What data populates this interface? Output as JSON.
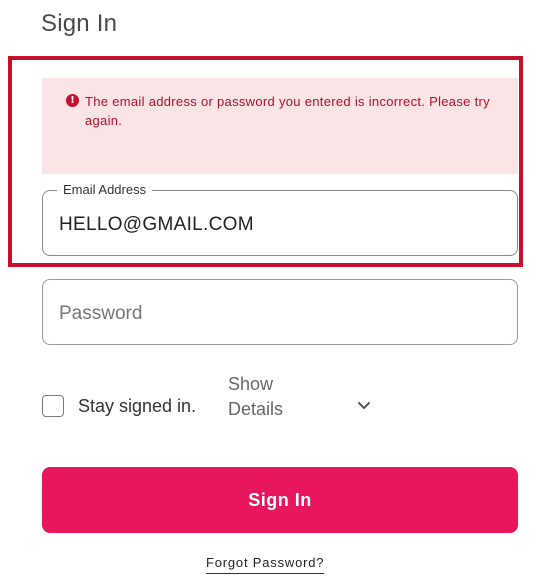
{
  "page": {
    "title": "Sign In"
  },
  "error": {
    "icon": "alert-circle-icon",
    "icon_glyph": "!",
    "message": "The email address or password you entered is incorrect. Please try again."
  },
  "email_field": {
    "label": "Email Address",
    "value": "HELLO@GMAIL.COM"
  },
  "password_field": {
    "placeholder": "Password"
  },
  "stay_signed_in": {
    "label": "Stay signed in.",
    "checked": false
  },
  "show_details": {
    "line1": "Show",
    "line2": "Details",
    "icon": "chevron-down-icon"
  },
  "signin_button": {
    "label": "Sign In"
  },
  "forgot_link": {
    "label": "Forgot Password?"
  },
  "colors": {
    "accent": "#e8175d",
    "error_text": "#b0102a",
    "error_background": "#fbe4e6",
    "highlight_frame": "#c8102e"
  }
}
